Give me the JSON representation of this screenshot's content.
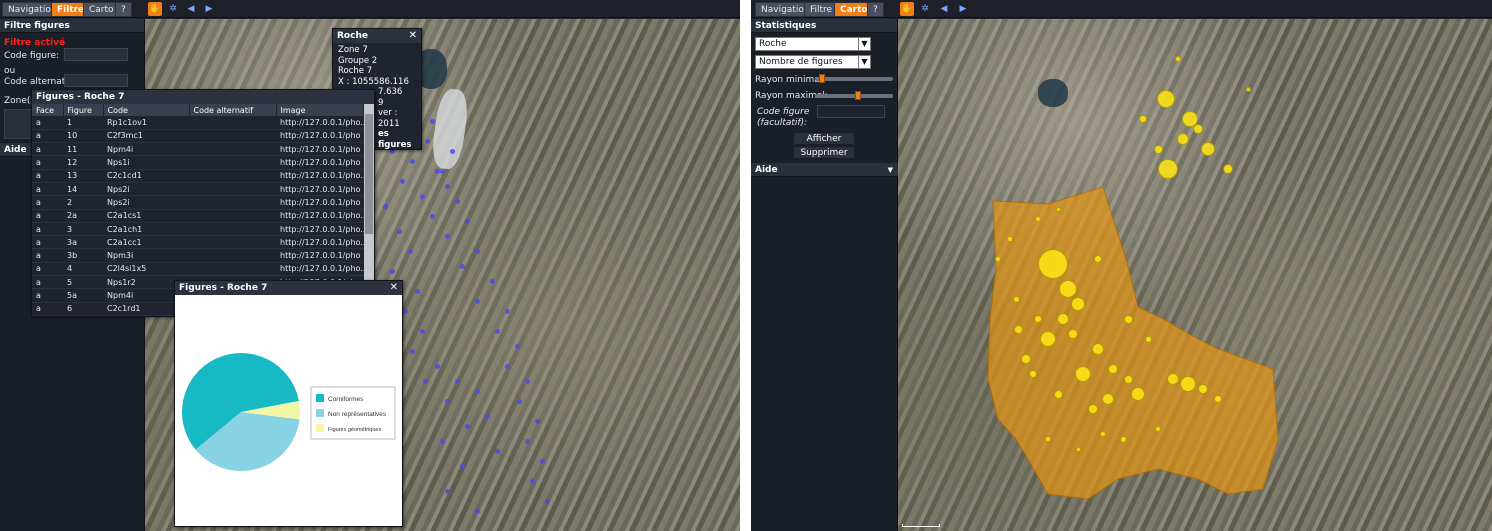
{
  "left": {
    "tabs": [
      "Navigation",
      "Filtre",
      "Carto",
      "?"
    ],
    "active_tab": "Filtre",
    "filter_panel": {
      "title": "Filtre figures",
      "status": "Filtre activé",
      "code_figure_label": "Code figure:",
      "ou_label": "ou",
      "code_alt_label": "Code alternatif:",
      "zone_label": "Zone(s"
    },
    "aide_label": "Aide",
    "roche_popup": {
      "title": "Roche",
      "lines": [
        "Zone 7",
        "Groupe 2",
        "Roche 7",
        "X : 1055586.116",
        "7.636",
        "9",
        "ver : 2011",
        "es figures",
        "figures",
        "che"
      ]
    },
    "figures_table": {
      "title": "Figures - Roche 7",
      "columns": [
        "Face",
        "Figure",
        "Code",
        "Code alternatif",
        "Image"
      ],
      "rows": [
        [
          "a",
          "1",
          "Rp1c1ov1",
          "",
          "http://127.0.0.1/pho..."
        ],
        [
          "a",
          "10",
          "C2f3mc1",
          "",
          "http://127.0.0.1/pho"
        ],
        [
          "a",
          "11",
          "Npm4i",
          "",
          "http://127.0.0.1/pho"
        ],
        [
          "a",
          "12",
          "Nps1i",
          "",
          "http://127.0.0.1/pho"
        ],
        [
          "a",
          "13",
          "C2c1cd1",
          "",
          "http://127.0.0.1/pho..."
        ],
        [
          "a",
          "14",
          "Nps2i",
          "",
          "http://127.0.0.1/pho"
        ],
        [
          "a",
          "2",
          "Nps2i",
          "",
          "http://127.0.0.1/pho"
        ],
        [
          "a",
          "2a",
          "C2a1cs1",
          "",
          "http://127.0.0.1/pho..."
        ],
        [
          "a",
          "3",
          "C2a1ch1",
          "",
          "http://127.0.0.1/pho..."
        ],
        [
          "a",
          "3a",
          "C2a1cc1",
          "",
          "http://127.0.0.1/pho..."
        ],
        [
          "a",
          "3b",
          "Npm3i",
          "",
          "http://127.0.0.1/pho"
        ],
        [
          "a",
          "4",
          "C2l4si1x5",
          "",
          "http://127.0.0.1/pho..."
        ],
        [
          "a",
          "5",
          "Nps1r2",
          "",
          "http://127.0.0.1/pho"
        ],
        [
          "a",
          "5a",
          "Npm4i",
          "",
          "http://127.0.0.1/pho"
        ],
        [
          "a",
          "6",
          "C2c1rd1",
          "",
          "http://127.0.0.1/pho..."
        ]
      ]
    },
    "pie_window": {
      "title": "Figures - Roche 7",
      "chart_data": {
        "type": "pie",
        "categories": [
          "Corniformes",
          "Non représentatives",
          "Figures géométriques"
        ],
        "values": [
          58,
          37,
          5
        ],
        "colors": [
          "#17b9c4",
          "#87d3e3",
          "#f2f7a5"
        ],
        "legend_position": "right"
      }
    }
  },
  "right": {
    "tabs": [
      "Navigation",
      "Filtre",
      "Carto",
      "?"
    ],
    "active_tab": "Carto",
    "stats_panel": {
      "title": "Statistiques",
      "select1": "Roche",
      "select2": "Nombre de figures",
      "rayon_min_label": "Rayon minimal:",
      "rayon_max_label": "Rayon maximal:",
      "code_figure_label": "Code figure",
      "facultatif_label": "(facultatif):",
      "afficher_label": "Afficher",
      "supprimer_label": "Supprimer",
      "rayon_min_value": 0.05,
      "rayon_max_value": 0.55
    },
    "aide_label": "Aide"
  }
}
